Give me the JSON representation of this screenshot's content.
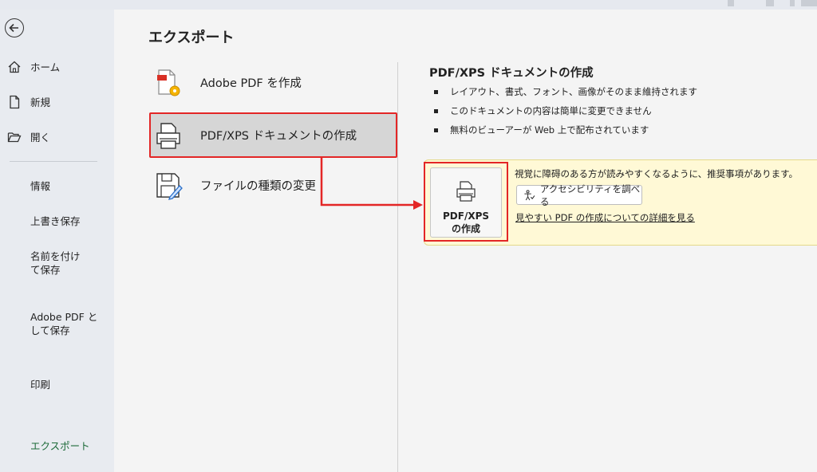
{
  "sidebar": {
    "items": [
      {
        "label": "ホーム",
        "icon": "home-icon"
      },
      {
        "label": "新規",
        "icon": "new-document-icon"
      },
      {
        "label": "開く",
        "icon": "open-folder-icon"
      }
    ],
    "sub_items": [
      {
        "label": "情報"
      },
      {
        "label": "上書き保存"
      },
      {
        "label": "名前を付けて保存"
      },
      {
        "label": "Adobe PDF として保存"
      },
      {
        "label": "印刷"
      },
      {
        "label": "エクスポート"
      }
    ],
    "active": "エクスポート",
    "active_color": "#1e6b3a"
  },
  "main": {
    "title": "エクスポート",
    "options": [
      {
        "label": "Adobe PDF を作成",
        "icon": "adobe-pdf-icon"
      },
      {
        "label": "PDF/XPS ドキュメントの作成",
        "icon": "printer-icon",
        "selected": true
      },
      {
        "label": "ファイルの種類の変更",
        "icon": "file-type-change-icon"
      }
    ]
  },
  "detail": {
    "title": "PDF/XPS ドキュメントの作成",
    "bullets": [
      "レイアウト、書式、フォント、画像がそのまま維持されます",
      "このドキュメントの内容は簡単に変更できません",
      "無料のビューアーが Web 上で配布されています"
    ],
    "create_button": {
      "line1": "PDF/XPS",
      "line2": "の作成"
    },
    "notice": "視覚に障碍のある方が読みやすくなるように、推奨事項があります。",
    "accessibility_button": "アクセシビリティを調べる",
    "link": "見やすい PDF の作成についての詳細を見る"
  },
  "colors": {
    "highlight": "#e32626",
    "panel_bg": "#fff9d6"
  }
}
